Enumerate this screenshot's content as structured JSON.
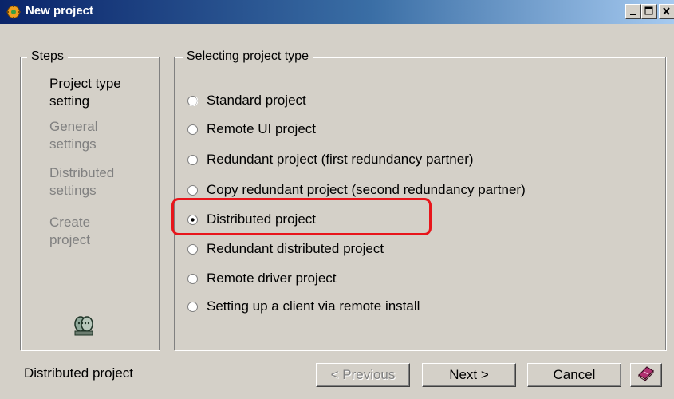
{
  "window": {
    "title": "New project",
    "icon": "gear-app-icon"
  },
  "steps": {
    "legend": "Steps",
    "items": [
      {
        "line1": "Project type",
        "line2": "setting",
        "active": true
      },
      {
        "line1": "General",
        "line2": "settings",
        "active": false
      },
      {
        "line1": "Distributed",
        "line2": "settings",
        "active": false
      },
      {
        "line1": "Create",
        "line2": "project",
        "active": false
      }
    ],
    "icon": "people-icon"
  },
  "project_type": {
    "legend": "Selecting project type",
    "options": [
      {
        "label": "Standard project",
        "selected": false
      },
      {
        "label": "Remote UI project",
        "selected": false
      },
      {
        "label": "Redundant project (first redundancy partner)",
        "selected": false
      },
      {
        "label": "Copy redundant project (second redundancy partner)",
        "selected": false
      },
      {
        "label": "Distributed project",
        "selected": true
      },
      {
        "label": "Redundant distributed project",
        "selected": false
      },
      {
        "label": "Remote driver project",
        "selected": false
      },
      {
        "label": "Setting up a client via remote install",
        "selected": false
      }
    ],
    "highlight_color": "#e8151b"
  },
  "footer": {
    "status": "Distributed project",
    "previous_label": "< Previous",
    "next_label": "Next >",
    "cancel_label": "Cancel",
    "help_icon": "help-book-icon"
  }
}
